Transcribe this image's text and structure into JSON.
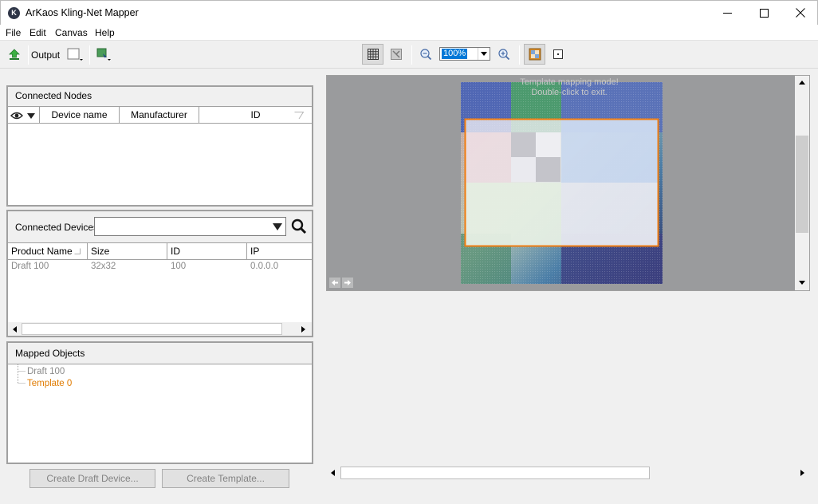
{
  "window": {
    "title": "ArKaos Kling-Net Mapper",
    "icon": "arkaos-logo-icon"
  },
  "menu": [
    "File",
    "Edit",
    "Canvas",
    "Help"
  ],
  "toolbar": {
    "output_label": "Output",
    "zoom": {
      "value": "100%"
    }
  },
  "connected_nodes": {
    "title": "Connected Nodes",
    "columns": [
      "Device name",
      "Manufacturer",
      "ID"
    ]
  },
  "connected_devices": {
    "title": "Connected Devices",
    "filter_value": "",
    "columns": [
      "Product Name",
      "Size",
      "ID",
      "IP"
    ],
    "rows": [
      {
        "product": "Draft 100",
        "size": "32x32",
        "id": "100",
        "ip": "0.0.0.0"
      }
    ]
  },
  "mapped_objects": {
    "title": "Mapped Objects",
    "items": [
      {
        "label": "Draft 100",
        "color": "#8a8a8a"
      },
      {
        "label": "Template 0",
        "color": "#e07b00"
      }
    ]
  },
  "buttons": {
    "create_draft": "Create Draft Device...",
    "create_template": "Create Template..."
  },
  "canvas": {
    "notice_line1": "Template mapping mode!",
    "notice_line2": "Double-click to exit.",
    "template_outline_color": "#f07d12"
  }
}
